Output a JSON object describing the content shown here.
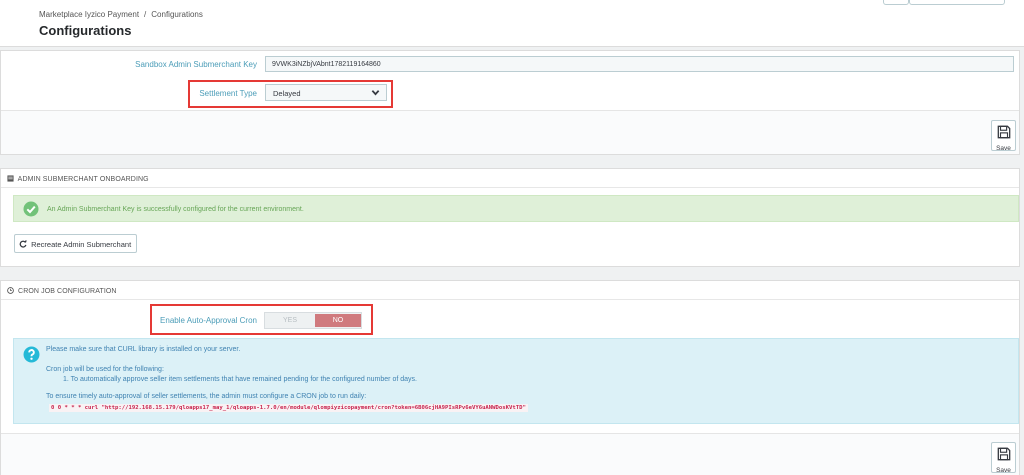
{
  "breadcrumb": {
    "parent": "Marketplace Iyzico Payment",
    "separator": "/",
    "current": "Configurations"
  },
  "page_title": "Configurations",
  "config": {
    "submerchant_key_label": "Sandbox Admin Submerchant Key",
    "submerchant_key_value": "9VWK3iNZbjVAbnt1782119164860",
    "settlement_type_label": "Settlement Type",
    "settlement_type_value": "Delayed",
    "save_label": "Save"
  },
  "onboarding": {
    "heading": "ADMIN SUBMERCHANT ONBOARDING",
    "success_message": "An Admin Submerchant Key is successfully configured for the current environment.",
    "recreate_button": "Recreate Admin Submerchant"
  },
  "cron": {
    "heading": "CRON JOB CONFIGURATION",
    "auto_approval_label": "Enable Auto-Approval Cron",
    "toggle_yes": "YES",
    "toggle_no": "NO",
    "toggle_selected": "NO",
    "info_line1": "Please make sure that CURL library is installed on your server.",
    "info_line2": "Cron job will be used for the following:",
    "info_line3": "1. To automatically approve seller item settlements that have remained pending for the configured number of days.",
    "info_line4": "To ensure timely auto-approval of seller settlements, the admin must configure a CRON job to run daily:",
    "cron_command": "0 0 * * * curl \"http://192.168.15.179/qloapps17_may_1/qloapps-1.7.0/en/module/qlompiyzicopayment/cron?token=6B06cjHA9PIsRPv6eVY6uANWDosKVtTD\"",
    "save_label": "Save"
  },
  "colors": {
    "label_blue": "#4c9db8",
    "highlight_red": "#e53935",
    "toggle_no": "#d07a7e",
    "success_bg": "#dff0d8",
    "info_bg": "#dcf1f7"
  }
}
